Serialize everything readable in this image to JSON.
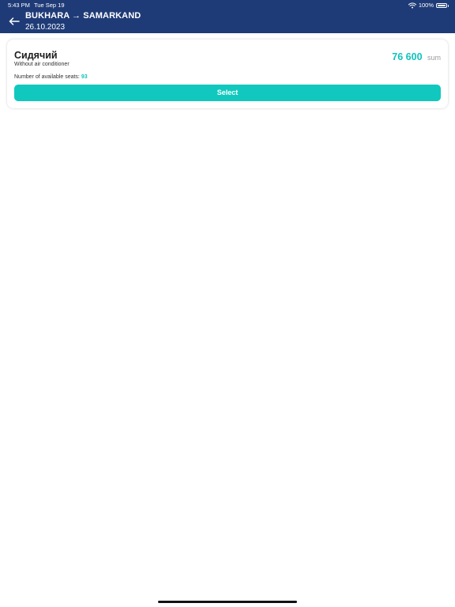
{
  "status_bar": {
    "time": "5:43 PM",
    "date": "Tue Sep 19",
    "battery": "100%",
    "wifi_icon": "wifi-icon",
    "battery_icon": "battery-icon"
  },
  "header": {
    "back_icon": "arrow-left-icon",
    "route": "BUKHARA → SAMARKAND",
    "date": "26.10.2023",
    "background_color": "#1f3b77"
  },
  "ticket": {
    "car_type": "Сидячий",
    "amenities": "Without air conditioner",
    "seats_label": "Number of available seats:",
    "seats_count": "93",
    "price": "76 600",
    "currency": "sum",
    "select_label": "Select",
    "accent_color": "#11c8be"
  }
}
